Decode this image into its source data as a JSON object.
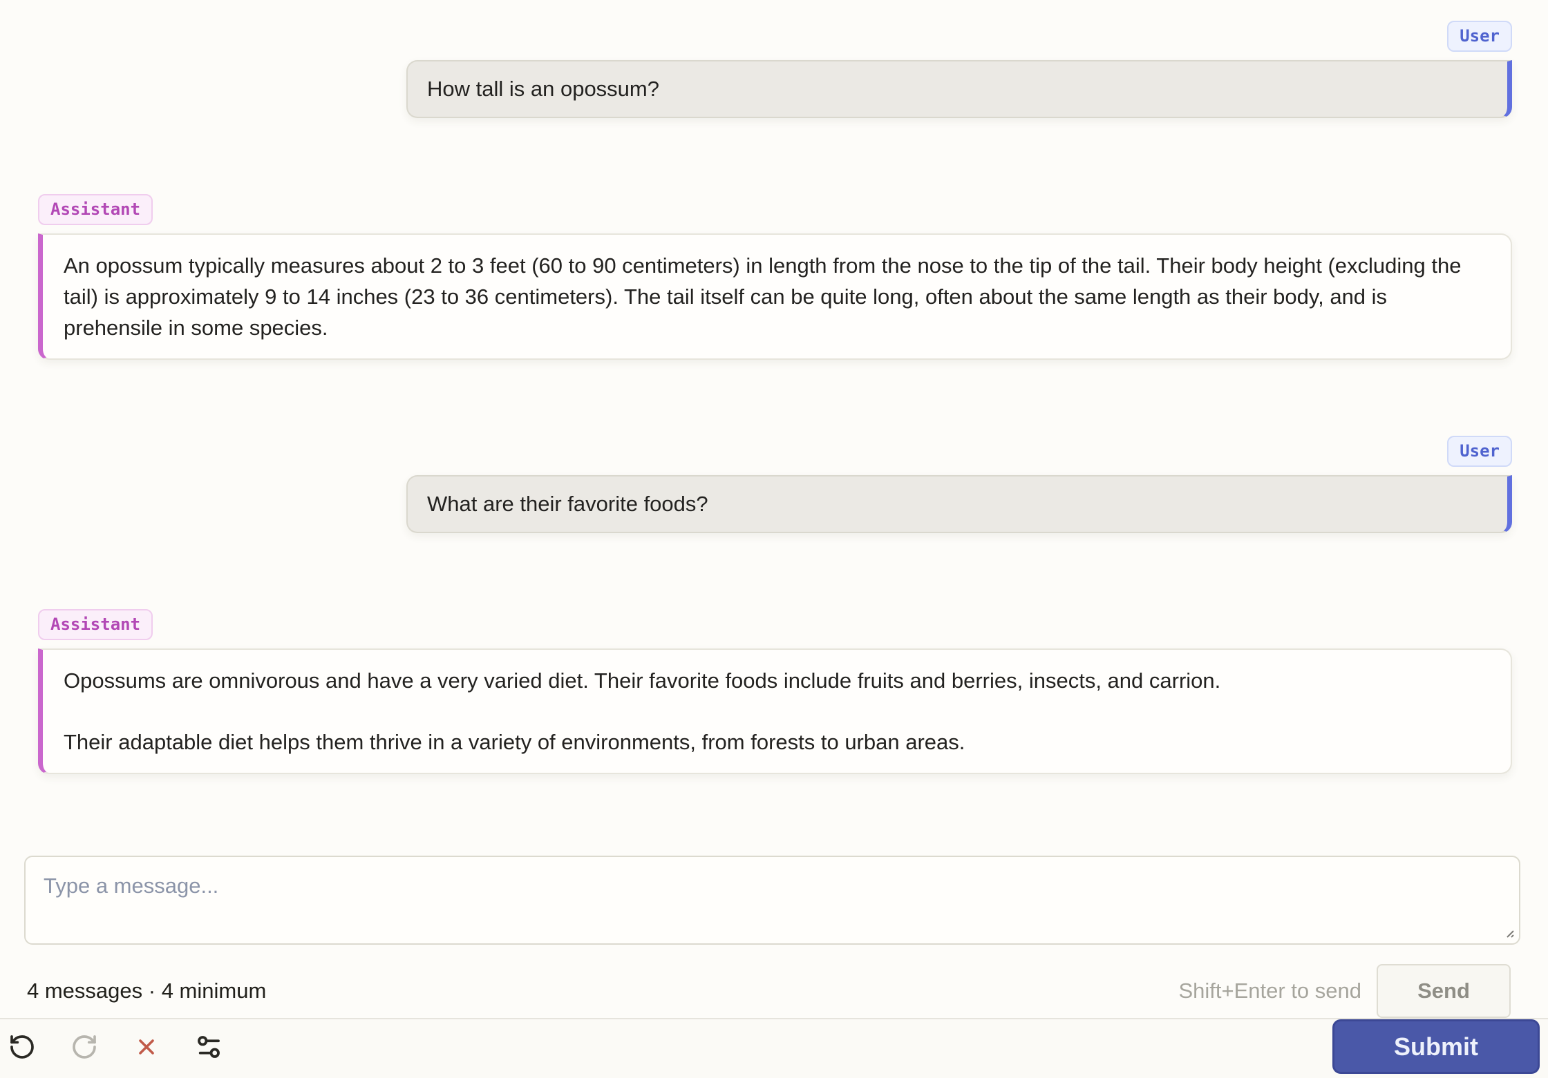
{
  "conversation": {
    "messages": [
      {
        "role": "user",
        "label": "User",
        "paragraphs": [
          "How tall is an opossum?"
        ]
      },
      {
        "role": "assistant",
        "label": "Assistant",
        "paragraphs": [
          "An opossum typically measures about 2 to 3 feet (60 to 90 centimeters) in length from the nose to the tip of the tail. Their body height (excluding the tail) is approximately 9 to 14 inches (23 to 36 centimeters). The tail itself can be quite long, often about the same length as their body, and is prehensile in some species."
        ]
      },
      {
        "role": "user",
        "label": "User",
        "paragraphs": [
          "What are their favorite foods?"
        ]
      },
      {
        "role": "assistant",
        "label": "Assistant",
        "paragraphs": [
          "Opossums are omnivorous and have a very varied diet. Their favorite foods include fruits and berries, insects, and carrion.",
          "Their adaptable diet helps them thrive in a variety of environments, from forests to urban areas."
        ]
      }
    ]
  },
  "composer": {
    "placeholder": "Type a message...",
    "status": "4 messages · 4 minimum",
    "hint": "Shift+Enter to send",
    "send_label": "Send"
  },
  "toolbar": {
    "submit_label": "Submit",
    "icons": [
      "undo-icon",
      "redo-icon",
      "close-icon",
      "settings-sliders-icon"
    ]
  },
  "colors": {
    "page_bg": "#fdfcf9",
    "user_accent": "#6170df",
    "assistant_accent": "#ca67cd",
    "user_badge_text": "#4f63cf",
    "assistant_badge_text": "#b248b5",
    "user_bubble_bg": "#ebe9e4",
    "assistant_bubble_bg": "#fffefc",
    "submit_bg": "#4a58a8",
    "close_icon": "#c15a49"
  }
}
